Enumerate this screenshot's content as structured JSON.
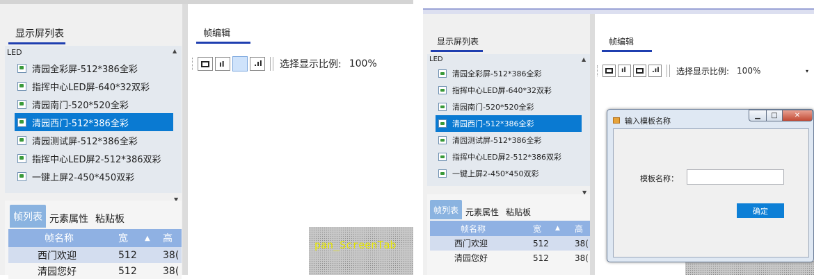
{
  "left": {
    "sidebar_tab": "显示屏列表",
    "group": "LED",
    "items": [
      "清园全彩屏-512*386全彩",
      "指挥中心LED屏-640*32双彩",
      "清园南门-520*520全彩",
      "清园西门-512*386全彩",
      "清园测试屏-512*386全彩",
      "指挥中心LED屏2-512*386双彩",
      "一键上屏2-450*450双彩"
    ],
    "selected_index": 3,
    "editor_tab": "帧编辑",
    "zoom_label": "选择显示比例:",
    "zoom_value": "100%",
    "bottom_tabs": [
      "帧列表",
      "元素属性",
      "粘贴板"
    ],
    "columns": [
      "帧名称",
      "宽",
      "▲",
      "高"
    ],
    "rows": [
      [
        "西门欢迎",
        "512",
        "38("
      ],
      [
        "清园您好",
        "512",
        "38("
      ]
    ],
    "overlay_text": "pan_ScreenTab"
  },
  "right": {
    "sidebar_tab": "显示屏列表",
    "group": "LED",
    "items": [
      "清园全彩屏-512*386全彩",
      "指挥中心LED屏-640*32双彩",
      "清园南门-520*520全彩",
      "清园西门-512*386全彩",
      "清园测试屏-512*386全彩",
      "指挥中心LED屏2-512*386双彩",
      "一键上屏2-450*450双彩"
    ],
    "selected_index": 3,
    "editor_tab": "帧编辑",
    "zoom_label": "选择显示比例:",
    "zoom_value": "100%",
    "bottom_tabs": [
      "帧列表",
      "元素属性",
      "粘贴板"
    ],
    "columns": [
      "帧名称",
      "宽",
      "▲",
      "高"
    ],
    "rows": [
      [
        "西门欢迎",
        "512",
        "38("
      ],
      [
        "清园您好",
        "512",
        "38("
      ]
    ]
  },
  "dialog": {
    "title": "输入模板名称",
    "field_label": "模板名称：",
    "field_value": "",
    "ok_label": "确定"
  },
  "colors": {
    "accent": "#1f3fb0",
    "selected": "#0a7ad2",
    "list_bg": "#e4e9ef",
    "header_bg": "#8fb1e3"
  }
}
